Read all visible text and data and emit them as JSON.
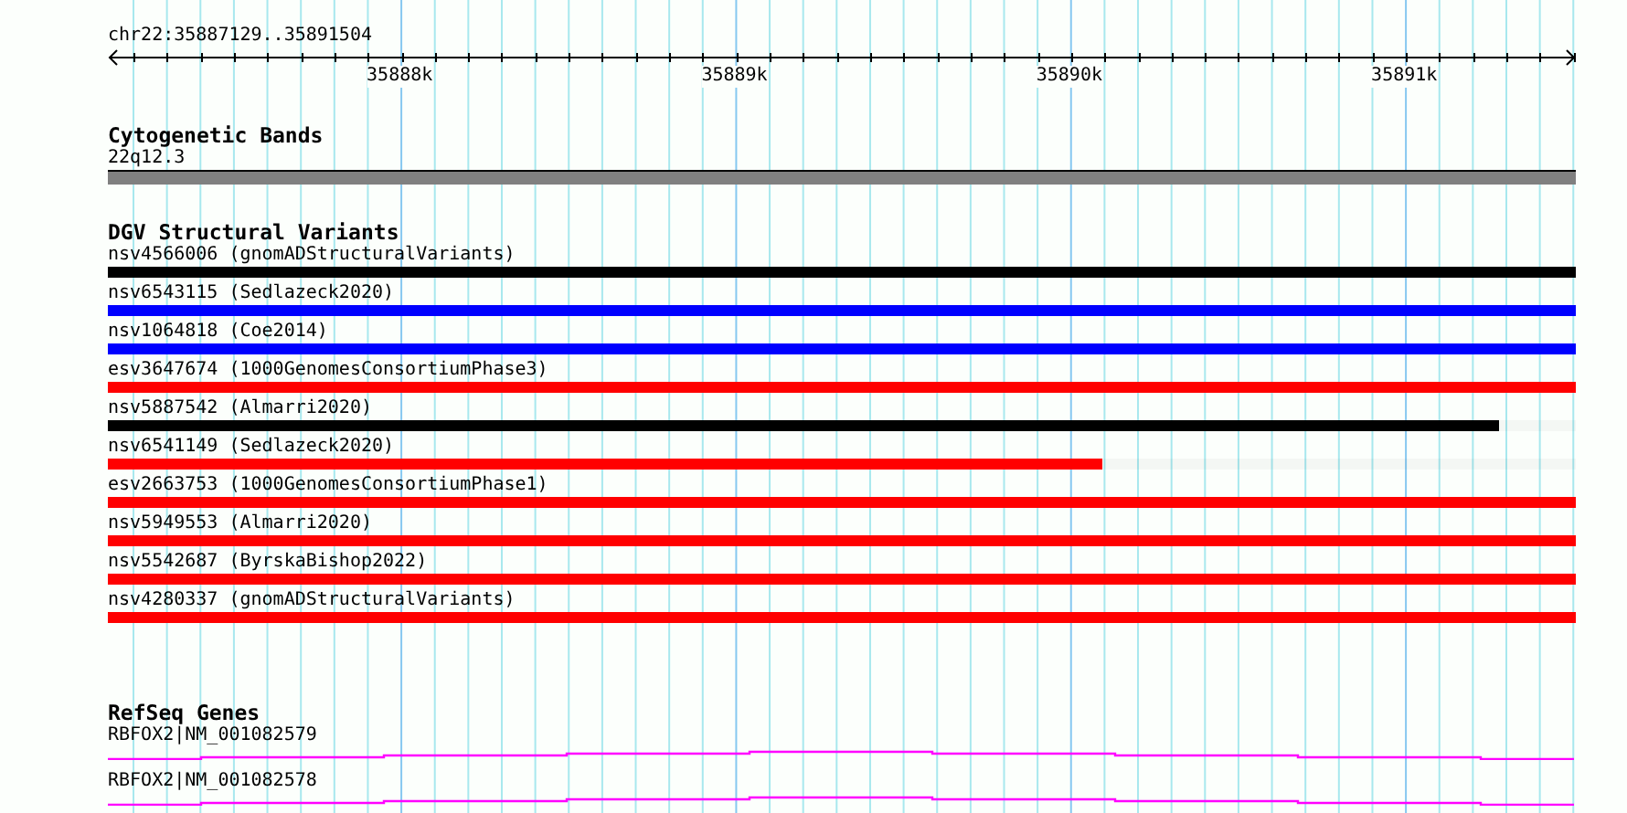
{
  "ruler": {
    "location": "chr22:35887129..35891504",
    "tick_labels": [
      "35888k",
      "35889k",
      "35890k",
      "35891k"
    ]
  },
  "tracks": [
    {
      "kind": "bands",
      "title": "Cytogenetic Bands",
      "features": [
        {
          "label": "22q12.3"
        }
      ]
    },
    {
      "kind": "variants",
      "title": "DGV Structural Variants",
      "features": [
        {
          "label": "nsv4566006 (gnomADStructuralVariants)",
          "color": "#000000",
          "level": 1
        },
        {
          "label": "nsv6543115 (Sedlazeck2020)",
          "color": "#0000ff",
          "level": 1
        },
        {
          "label": "nsv1064818 (Coe2014)",
          "color": "#0000ff",
          "level": 1
        },
        {
          "label": "esv3647674 (1000GenomesConsortiumPhase3)",
          "color": "#ff0000",
          "level": 1
        },
        {
          "label": "nsv5887542 (Almarri2020)",
          "color": "#000000",
          "level": 0.948
        },
        {
          "label": "nsv6541149 (Sedlazeck2020)",
          "color": "#ff0000",
          "level": 0.677
        },
        {
          "label": "esv2663753 (1000GenomesConsortiumPhase1)",
          "color": "#ff0000",
          "level": 1
        },
        {
          "label": "nsv5949553 (Almarri2020)",
          "color": "#ff0000",
          "level": 1
        },
        {
          "label": "nsv5542687 (ByrskaBishop2022)",
          "color": "#ff0000",
          "level": 1
        },
        {
          "label": "nsv4280337 (gnomADStructuralVariants)",
          "color": "#ff0000",
          "level": 1
        }
      ]
    },
    {
      "kind": "genes",
      "title": "RefSeq Genes",
      "features": [
        {
          "label": "RBFOX2|NM_001082579"
        },
        {
          "label": "RBFOX2|NM_001082578"
        }
      ]
    }
  ]
}
